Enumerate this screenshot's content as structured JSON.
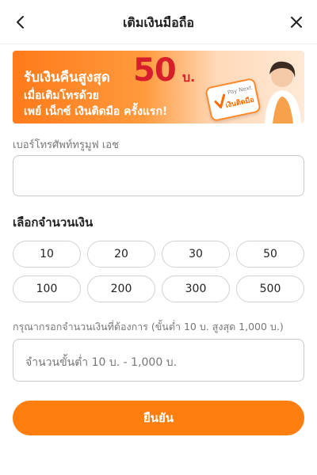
{
  "header": {
    "title": "เติมเงินมือถือ",
    "back_icon": "chevron-left-icon",
    "close_icon": "close-icon"
  },
  "banner": {
    "line1": "รับเงินคืนสูงสุด",
    "amount": "50",
    "currency": "บ.",
    "line2": "เมื่อเติมโทรด้วย",
    "line3": "เพย์ เน็กซ์ เงินติดมือ ครั้งแรก!",
    "card_brand": "Pay Next",
    "card_title": "เงินติดมือ",
    "accent_color": "#ff7a1a",
    "amount_color": "#d61f2b"
  },
  "phone": {
    "label": "เบอร์โทรศัพท์ทรูมูฟ เอช",
    "value": ""
  },
  "amount_select": {
    "title": "เลือกจำนวนเงิน",
    "options": [
      "10",
      "20",
      "30",
      "50",
      "100",
      "200",
      "300",
      "500"
    ]
  },
  "custom_amount": {
    "label": "กรุณากรอกจำนวนเงินที่ต้องการ (ขั้นต่ำ 10 บ. สูงสุด 1,000 บ.)",
    "placeholder": "จำนวนขั้นต่ำ 10 บ. - 1,000 บ."
  },
  "confirm": {
    "label": "ยืนยัน",
    "color": "#ff7e0d"
  }
}
